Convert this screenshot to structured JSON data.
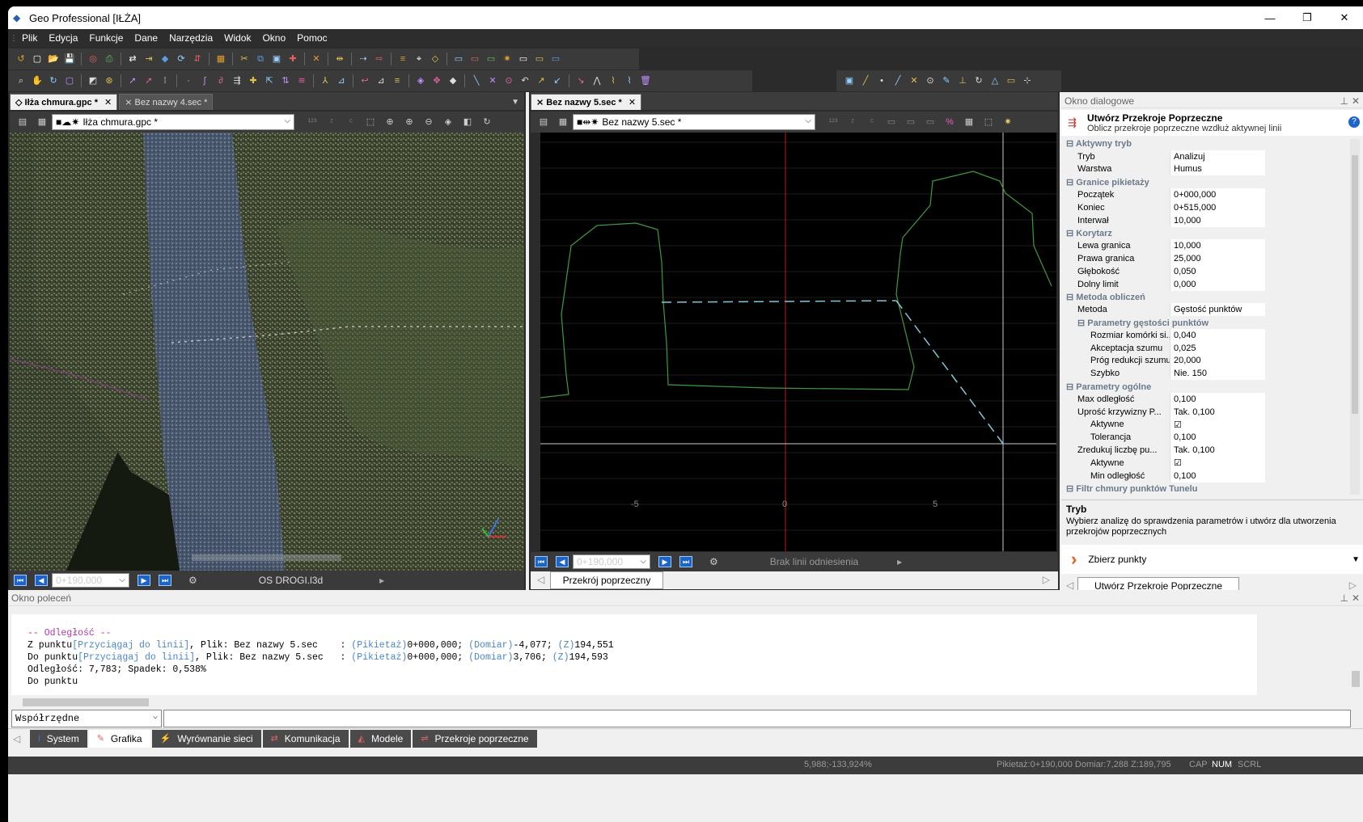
{
  "window": {
    "title": "Geo Professional [IŁŻA]"
  },
  "menu": [
    "Plik",
    "Edycja",
    "Funkcje",
    "Dane",
    "Narzędzia",
    "Widok",
    "Okno",
    "Pomoc"
  ],
  "left_pane": {
    "tabs": [
      {
        "label": "Iłża chmura.gpc *",
        "active": true
      },
      {
        "label": "Bez nazwy 4.sec *",
        "active": false
      }
    ],
    "layer_combo": "Iłża chmura.gpc *",
    "chainage": "0+190,000",
    "axis_file": "OS DROGI.l3d"
  },
  "mid_pane": {
    "tabs": [
      {
        "label": "Bez nazwy 5.sec *",
        "active": true
      }
    ],
    "layer_combo": "Bez nazwy 5.sec *",
    "chainage": "0+190,000",
    "ref_line": "Brak linii odniesienia",
    "bottom_tab": "Przekrój poprzeczny",
    "axis_ticks": [
      "-5",
      "0",
      "5"
    ]
  },
  "dialog": {
    "header": "Okno dialogowe",
    "title": "Utwórz Przekroje Poprzeczne",
    "subtitle": "Oblicz przekroje poprzeczne wzdłuż aktywnej linii",
    "rows": [
      {
        "t": "grp",
        "k": "Aktywny tryb",
        "v": ""
      },
      {
        "t": "row",
        "k": "Tryb",
        "v": "Analizuj"
      },
      {
        "t": "row",
        "k": "Warstwa",
        "v": "Humus"
      },
      {
        "t": "grp",
        "k": "Granice pikietaży",
        "v": ""
      },
      {
        "t": "row",
        "k": "Początek",
        "v": "0+000,000"
      },
      {
        "t": "row",
        "k": "Koniec",
        "v": "0+515,000"
      },
      {
        "t": "row",
        "k": "Interwał",
        "v": "10,000"
      },
      {
        "t": "grp",
        "k": "Korytarz",
        "v": ""
      },
      {
        "t": "row",
        "k": "Lewa granica",
        "v": "10,000"
      },
      {
        "t": "row",
        "k": "Prawa granica",
        "v": "25,000"
      },
      {
        "t": "row",
        "k": "Głębokość",
        "v": "0,050"
      },
      {
        "t": "row",
        "k": "Dolny limit",
        "v": "0,000"
      },
      {
        "t": "grp",
        "k": "Metoda obliczeń",
        "v": ""
      },
      {
        "t": "row",
        "k": "Metoda",
        "v": "Gęstość punktów"
      },
      {
        "t": "subg",
        "k": "Parametry gęstości punktów",
        "v": ""
      },
      {
        "t": "sub",
        "k": "Rozmiar komórki si...",
        "v": "0,040"
      },
      {
        "t": "sub",
        "k": "Akceptacja szumu",
        "v": "0,025"
      },
      {
        "t": "sub",
        "k": "Próg redukcji szumu",
        "v": "20,000"
      },
      {
        "t": "sub",
        "k": "Szybko",
        "v": "Nie. 150"
      },
      {
        "t": "grp",
        "k": "Parametry ogólne",
        "v": ""
      },
      {
        "t": "row",
        "k": "Max odległość",
        "v": "0,100"
      },
      {
        "t": "row",
        "k": "Uprość krzywizny P...",
        "v": "Tak. 0,100"
      },
      {
        "t": "sub",
        "k": "Aktywne",
        "v": "☑"
      },
      {
        "t": "sub",
        "k": "Tolerancja",
        "v": "0,100"
      },
      {
        "t": "row",
        "k": "Zredukuj liczbę pu...",
        "v": "Tak. 0,100"
      },
      {
        "t": "sub",
        "k": "Aktywne",
        "v": "☑"
      },
      {
        "t": "sub",
        "k": "Min odległość",
        "v": "0,100"
      },
      {
        "t": "grp",
        "k": "Filtr chmury punktów Tunelu",
        "v": ""
      }
    ],
    "help_title": "Tryb",
    "help_text": "Wybierz analizę do sprawdzenia parametrów i utwórz dla utworzenia przekrojów poprzecznych",
    "collect_button": "Zbierz punkty",
    "bottom_tab": "Utwórz Przekroje Poprzeczne"
  },
  "command": {
    "header": "Okno poleceń",
    "line1": "-- Odległość --",
    "line2a": "Z punktu",
    "line2b": "[Przyciągaj do linii]",
    "line2c": ", Plik: Bez nazwy 5.sec    : ",
    "line2d": "(Pikietaż)",
    "line2e": "0+000,000; ",
    "line2f": "(Domiar)",
    "line2g": "-4,077; ",
    "line2h": "(Z)",
    "line2i": "194,551",
    "line3a": "Do punktu",
    "line3b": "[Przyciągaj do linii]",
    "line3c": ", Plik: Bez nazwy 5.sec   : ",
    "line3d": "(Pikietaż)",
    "line3e": "0+000,000; ",
    "line3f": "(Domiar)",
    "line3g": "3,706; ",
    "line3h": "(Z)",
    "line3i": "194,593",
    "line4": "Odległość: 7,783; Spadek: 0,538%",
    "line5": "Do punktu",
    "coord_combo": "Współrzędne"
  },
  "bottom_tabs": [
    {
      "label": "System",
      "icon": "i"
    },
    {
      "label": "Grafika",
      "icon": "✎"
    },
    {
      "label": "Wyrównanie sieci",
      "icon": "⚡"
    },
    {
      "label": "Komunikacja",
      "icon": "⇄"
    },
    {
      "label": "Modele",
      "icon": "◭"
    },
    {
      "label": "Przekroje poprzeczne",
      "icon": "⇌"
    }
  ],
  "status": {
    "coords": "5,988;-133,924%",
    "section": "Pikietaż:0+190,000  Domiar:7,288  Z:189,795",
    "cap": "CAP",
    "num": "NUM",
    "scrl": "SCRL"
  },
  "colors": {
    "accent": "#1e64c8",
    "profile": "#3e9a3e",
    "centerline": "#c0161a",
    "dashed": "#7fc8d8"
  }
}
